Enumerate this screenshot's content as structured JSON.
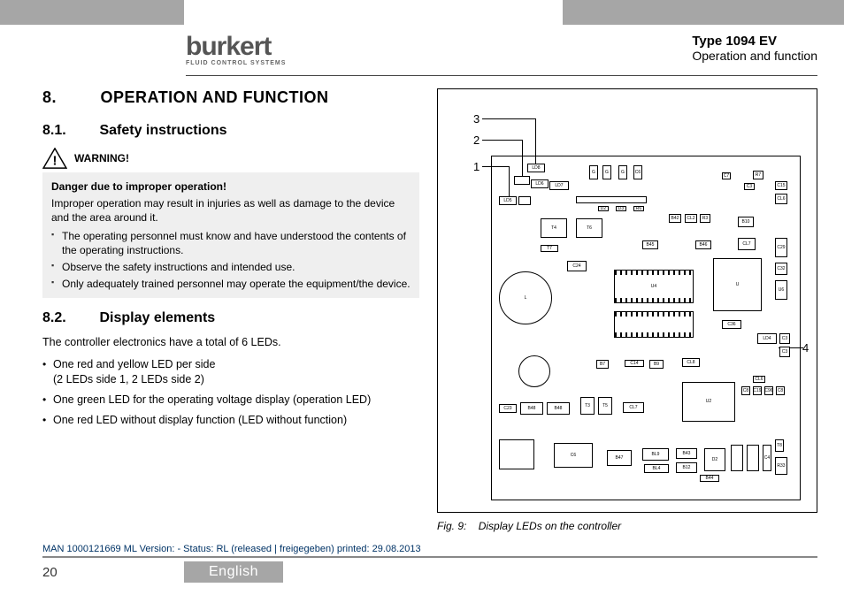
{
  "header": {
    "brand": "burkert",
    "brand_sub": "FLUID CONTROL SYSTEMS",
    "doc_type": "Type 1094 EV",
    "doc_section": "Operation and function"
  },
  "section": {
    "num": "8.",
    "title": "OPERATION AND FUNCTION"
  },
  "sub1": {
    "num": "8.1.",
    "title": "Safety instructions",
    "warn_label": "WARNING!",
    "danger_title": "Danger due to improper operation!",
    "danger_body": "Improper operation may result in injuries as well as damage to the device and the area around it.",
    "bullets": [
      "The operating personnel must know and have understood the contents of the operating instructions.",
      "Observe the safety instructions and intended use.",
      "Only adequately trained personnel may operate the equipment/the device."
    ]
  },
  "sub2": {
    "num": "8.2.",
    "title": "Display elements",
    "intro": "The controller electronics have a total of 6 LEDs.",
    "bullets": [
      "One red and yellow LED per side\n(2 LEDs side 1, 2 LEDs side 2)",
      "One green LED for the operating voltage display (operation LED)",
      "One red LED without display function (LED without function)"
    ]
  },
  "figure": {
    "callouts": [
      "1",
      "2",
      "3",
      "4"
    ],
    "caption_num": "Fig. 9:",
    "caption_text": "Display LEDs on the controller"
  },
  "footer": {
    "meta": "MAN 1000121669 ML Version: - Status: RL (released | freigegeben) printed: 29.08.2013",
    "page": "20",
    "language": "English"
  }
}
